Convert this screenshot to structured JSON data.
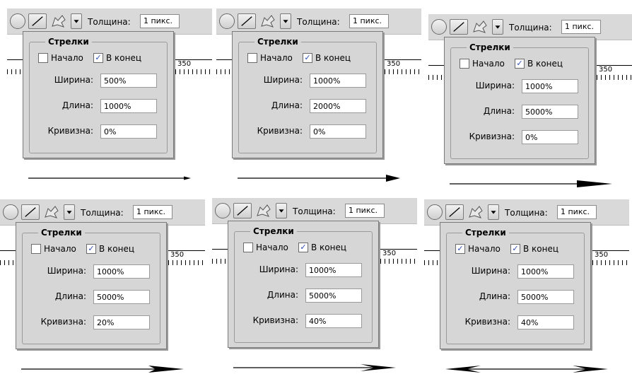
{
  "toolbar": {
    "thickness_label": "Толщина:",
    "thickness_value": "1 пикс.",
    "icons": [
      "ellipse-tool-icon",
      "line-tool-icon",
      "custom-shape-icon",
      "dropdown-arrow-icon"
    ]
  },
  "ruler": {
    "number": "350"
  },
  "popup": {
    "title": "Стрелки",
    "start_label": "Начало",
    "end_label": "В конец",
    "width_label": "Ширина:",
    "length_label": "Длина:",
    "curve_label": "Кривизна:"
  },
  "panels": [
    {
      "start_checked": false,
      "end_checked": true,
      "width": "500%",
      "length": "1000%",
      "curve": "0%",
      "arrow": {
        "width_pct": 500,
        "length_pct": 1000,
        "curve_pct": 0,
        "start": false,
        "end": true
      }
    },
    {
      "start_checked": false,
      "end_checked": true,
      "width": "1000%",
      "length": "2000%",
      "curve": "0%",
      "arrow": {
        "width_pct": 1000,
        "length_pct": 2000,
        "curve_pct": 0,
        "start": false,
        "end": true
      }
    },
    {
      "start_checked": false,
      "end_checked": true,
      "width": "1000%",
      "length": "5000%",
      "curve": "0%",
      "arrow": {
        "width_pct": 1000,
        "length_pct": 5000,
        "curve_pct": 0,
        "start": false,
        "end": true
      }
    },
    {
      "start_checked": false,
      "end_checked": true,
      "width": "1000%",
      "length": "5000%",
      "curve": "20%",
      "arrow": {
        "width_pct": 1000,
        "length_pct": 5000,
        "curve_pct": 20,
        "start": false,
        "end": true
      }
    },
    {
      "start_checked": false,
      "end_checked": true,
      "width": "1000%",
      "length": "5000%",
      "curve": "40%",
      "arrow": {
        "width_pct": 1000,
        "length_pct": 5000,
        "curve_pct": 40,
        "start": false,
        "end": true
      }
    },
    {
      "start_checked": true,
      "end_checked": true,
      "width": "1000%",
      "length": "5000%",
      "curve": "40%",
      "arrow": {
        "width_pct": 1000,
        "length_pct": 5000,
        "curve_pct": 40,
        "start": true,
        "end": true
      }
    }
  ],
  "colors": {
    "toolbar_bg": "#d9d9d9",
    "popup_bg": "#d6d6d6",
    "check_mark": "#2a4bb8",
    "arrow": "#000000"
  }
}
